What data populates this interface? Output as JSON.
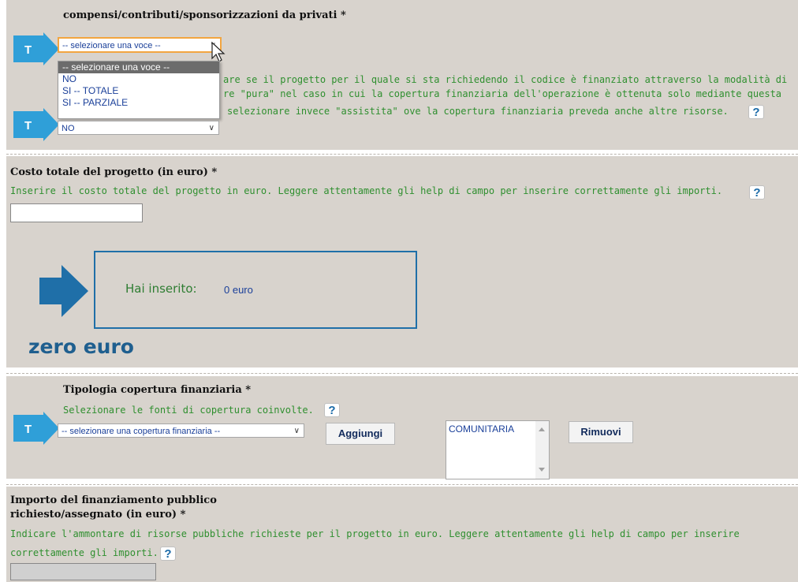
{
  "section_top": {
    "label": "compensi/contributi/sponsorizzazioni da privati *",
    "select_value": "-- selezionare una voce --",
    "dropdown_options": [
      "-- selezionare una voce --",
      "NO",
      "SI -- TOTALE",
      "SI -- PARZIALE"
    ],
    "help_line1": "are se il progetto per il quale si sta richiedendo il codice è finanziato attraverso la modalità di",
    "help_line2": "re \"pura\" nel caso in cui la copertura finanziaria dell'operazione è ottenuta solo mediante questa",
    "help_line3": "selezionare invece \"assistita\" ove la copertura finanziaria preveda anche altre risorse.",
    "second_select_value": "NO"
  },
  "costo": {
    "label": "Costo totale del progetto (in euro) *",
    "help": "Inserire il costo totale del progetto in euro. Leggere attentamente gli help di campo per inserire correttamente gli importi.",
    "input_value": "",
    "callout_label": "Hai inserito:",
    "callout_value": "0 euro",
    "big_text": "zero euro"
  },
  "tipologia": {
    "label": "Tipologia copertura finanziaria *",
    "help": "Selezionare le fonti di copertura coinvolte.",
    "select_value": "-- selezionare una copertura finanziaria --",
    "add_button": "Aggiungi",
    "list_items": [
      "COMUNITARIA"
    ],
    "remove_button": "Rimuovi"
  },
  "importo": {
    "label_line1": "Importo del finanziamento pubblico",
    "label_line2": "richiesto/assegnato (in euro) *",
    "help_line1": "Indicare l'ammontare di risorse pubbliche richieste per il progetto in euro. Leggere attentamente gli help di campo per inserire",
    "help_line2": "correttamente gli importi."
  },
  "glyphs": {
    "help_icon": "?",
    "t_marker": "T",
    "chevron": "∨"
  },
  "colors": {
    "help_text": "#2f8f2f",
    "arrow_blue": "#2f9fd8",
    "callout_blue": "#1f6fa8",
    "panel_bg": "#d8d3cd"
  }
}
